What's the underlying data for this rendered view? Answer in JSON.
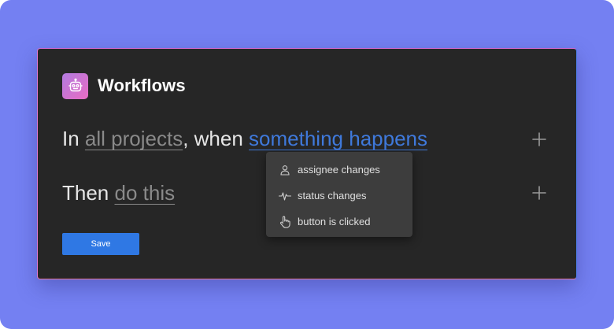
{
  "app": {
    "title": "Workflows",
    "logo_icon": "robot-icon",
    "accent_color": "#3f79db",
    "background_color": "#7480f2",
    "panel_color": "#262626"
  },
  "rule": {
    "trigger_prefix": "In",
    "scope_label": "all projects",
    "trigger_connector": ", when",
    "trigger_label": "something happens",
    "action_prefix": "Then",
    "action_label": "do this"
  },
  "dropdown": {
    "items": [
      {
        "label": "assignee changes",
        "icon": "person-icon"
      },
      {
        "label": "status changes",
        "icon": "pulse-icon"
      },
      {
        "label": "button is clicked",
        "icon": "hand-pointer-icon"
      }
    ]
  },
  "buttons": {
    "add_trigger_icon": "plus-icon",
    "add_action_icon": "plus-icon",
    "save_label": "Save"
  }
}
